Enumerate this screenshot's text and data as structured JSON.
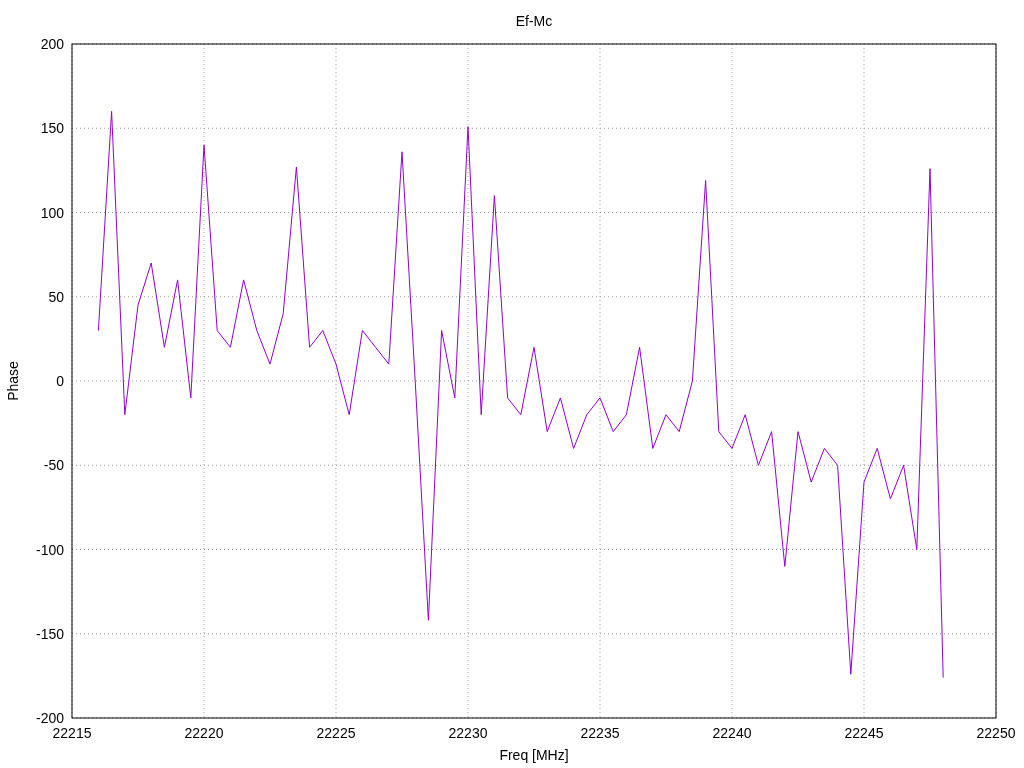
{
  "chart_data": {
    "type": "line",
    "title": "Ef-Mc",
    "xlabel": "Freq [MHz]",
    "ylabel": "Phase",
    "xlim": [
      22215,
      22250
    ],
    "ylim": [
      -200,
      200
    ],
    "grid": true,
    "xticks": [
      22215,
      22220,
      22225,
      22230,
      22235,
      22240,
      22245,
      22250
    ],
    "yticks": [
      -200,
      -150,
      -100,
      -50,
      0,
      50,
      100,
      150,
      200
    ],
    "x": [
      22216,
      22216.5,
      22217,
      22217.5,
      22218,
      22218.5,
      22219,
      22219.5,
      22220,
      22220.5,
      22221,
      22221.5,
      22222,
      22222.5,
      22223,
      22223.5,
      22224,
      22224.5,
      22225,
      22225.5,
      22226,
      22226.5,
      22227,
      22227.5,
      22228,
      22228.5,
      22229,
      22229.5,
      22230,
      22230.5,
      22231,
      22231.5,
      22232,
      22232.5,
      22233,
      22233.5,
      22234,
      22234.5,
      22235,
      22235.5,
      22236,
      22236.5,
      22237,
      22237.5,
      22238,
      22238.5,
      22239,
      22239.5,
      22240,
      22240.5,
      22241,
      22241.5,
      22242,
      22242.5,
      22243,
      22243.5,
      22244,
      22244.5,
      22245,
      22245.5,
      22246,
      22246.5,
      22247,
      22247.5,
      22248
    ],
    "series": [
      {
        "color": "#9400d3",
        "values": [
          30,
          160,
          -20,
          45,
          70,
          20,
          60,
          -10,
          140,
          30,
          20,
          60,
          30,
          10,
          40,
          127,
          20,
          30,
          10,
          -20,
          30,
          20,
          10,
          136,
          0,
          -142,
          30,
          -10,
          151,
          -20,
          110,
          -10,
          -20,
          20,
          -30,
          -10,
          -40,
          -20,
          -10,
          -30,
          -20,
          20,
          -40,
          -20,
          -30,
          0,
          119,
          -30,
          -40,
          -20,
          -50,
          -30,
          -110,
          -30,
          -60,
          -40,
          -50,
          -174,
          -60,
          -40,
          -70,
          -50,
          -100,
          126,
          -176
        ]
      }
    ]
  }
}
